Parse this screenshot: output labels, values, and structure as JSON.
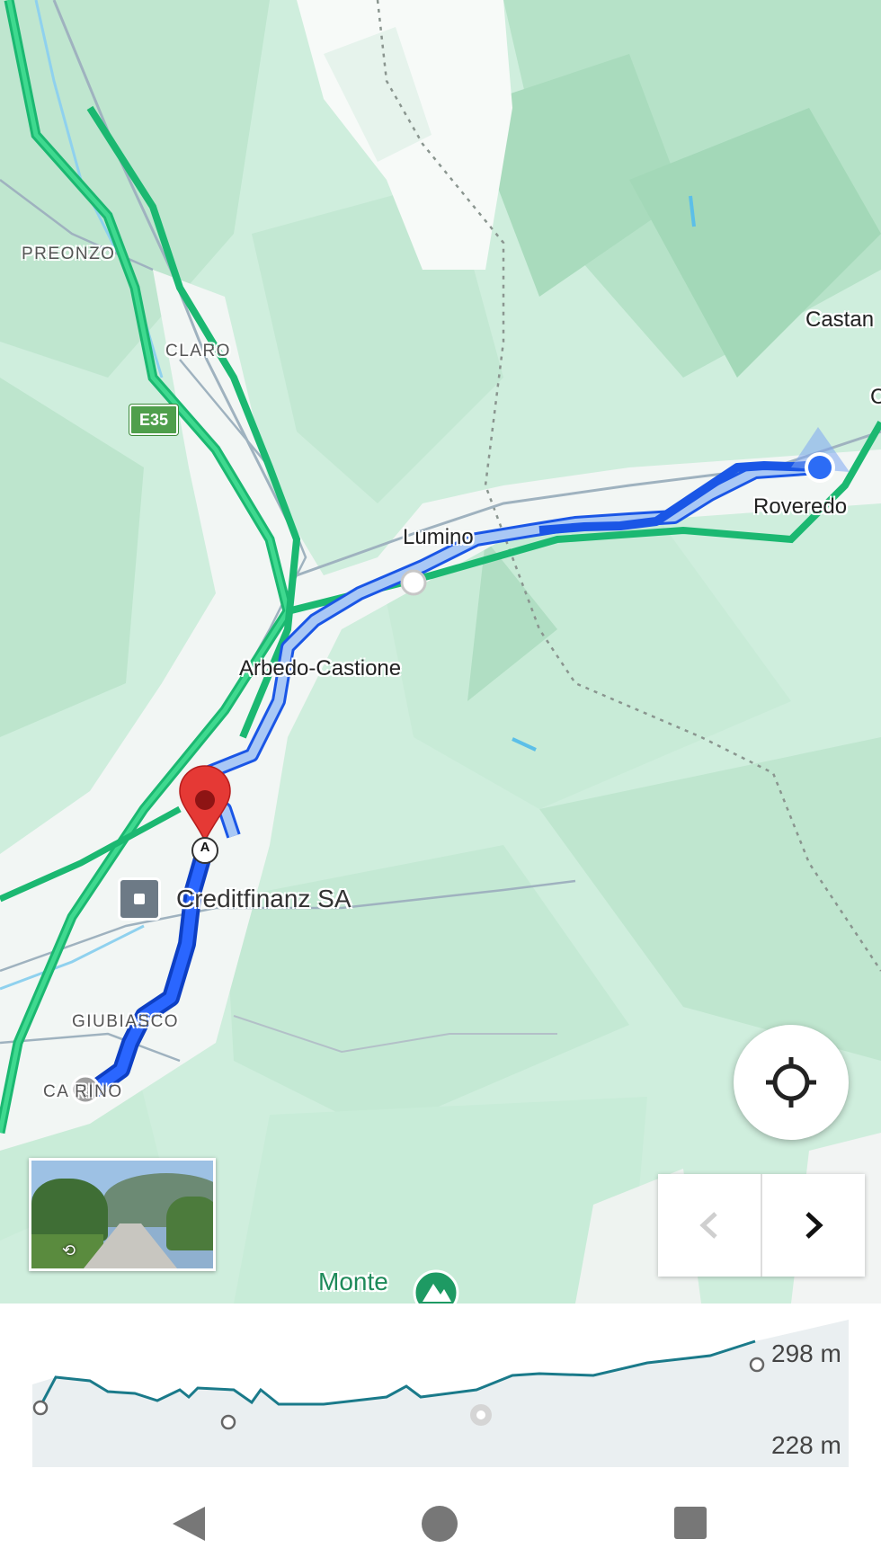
{
  "map": {
    "labels": {
      "preonzo": "PREONZO",
      "claro": "CLARO",
      "castan": "Castan",
      "roveredo": "Roveredo",
      "lumino": "Lumino",
      "arbedo": "Arbedo-Castione",
      "creditfinanz": "Creditfinanz SA",
      "giubiasco": "GIUBIASCO",
      "camorino": "CA  RINO",
      "monte": "Monte",
      "c_partial": "C"
    },
    "road_shield": "E35",
    "marker_letter": "A",
    "icons": {
      "poi": "building-icon",
      "marker": "red-pin-icon",
      "current_location": "blue-dot-icon",
      "park": "park-icon",
      "locate": "my-location-icon",
      "prev": "chevron-left-icon",
      "next": "chevron-right-icon",
      "street_view_rotate": "rotate-360-icon"
    },
    "colors": {
      "route_active": "#1a56e6",
      "route_alt": "#a9c8f5",
      "highway": "#1fbf7a",
      "terrain": "#cfeedd",
      "marker": "#e53935"
    }
  },
  "elevation": {
    "max_label": "298 m",
    "min_label": "228 m",
    "line_color": "#1a7a8a"
  },
  "system_nav": {
    "back": "back-triangle-icon",
    "home": "home-circle-icon",
    "recents": "recents-square-icon"
  }
}
